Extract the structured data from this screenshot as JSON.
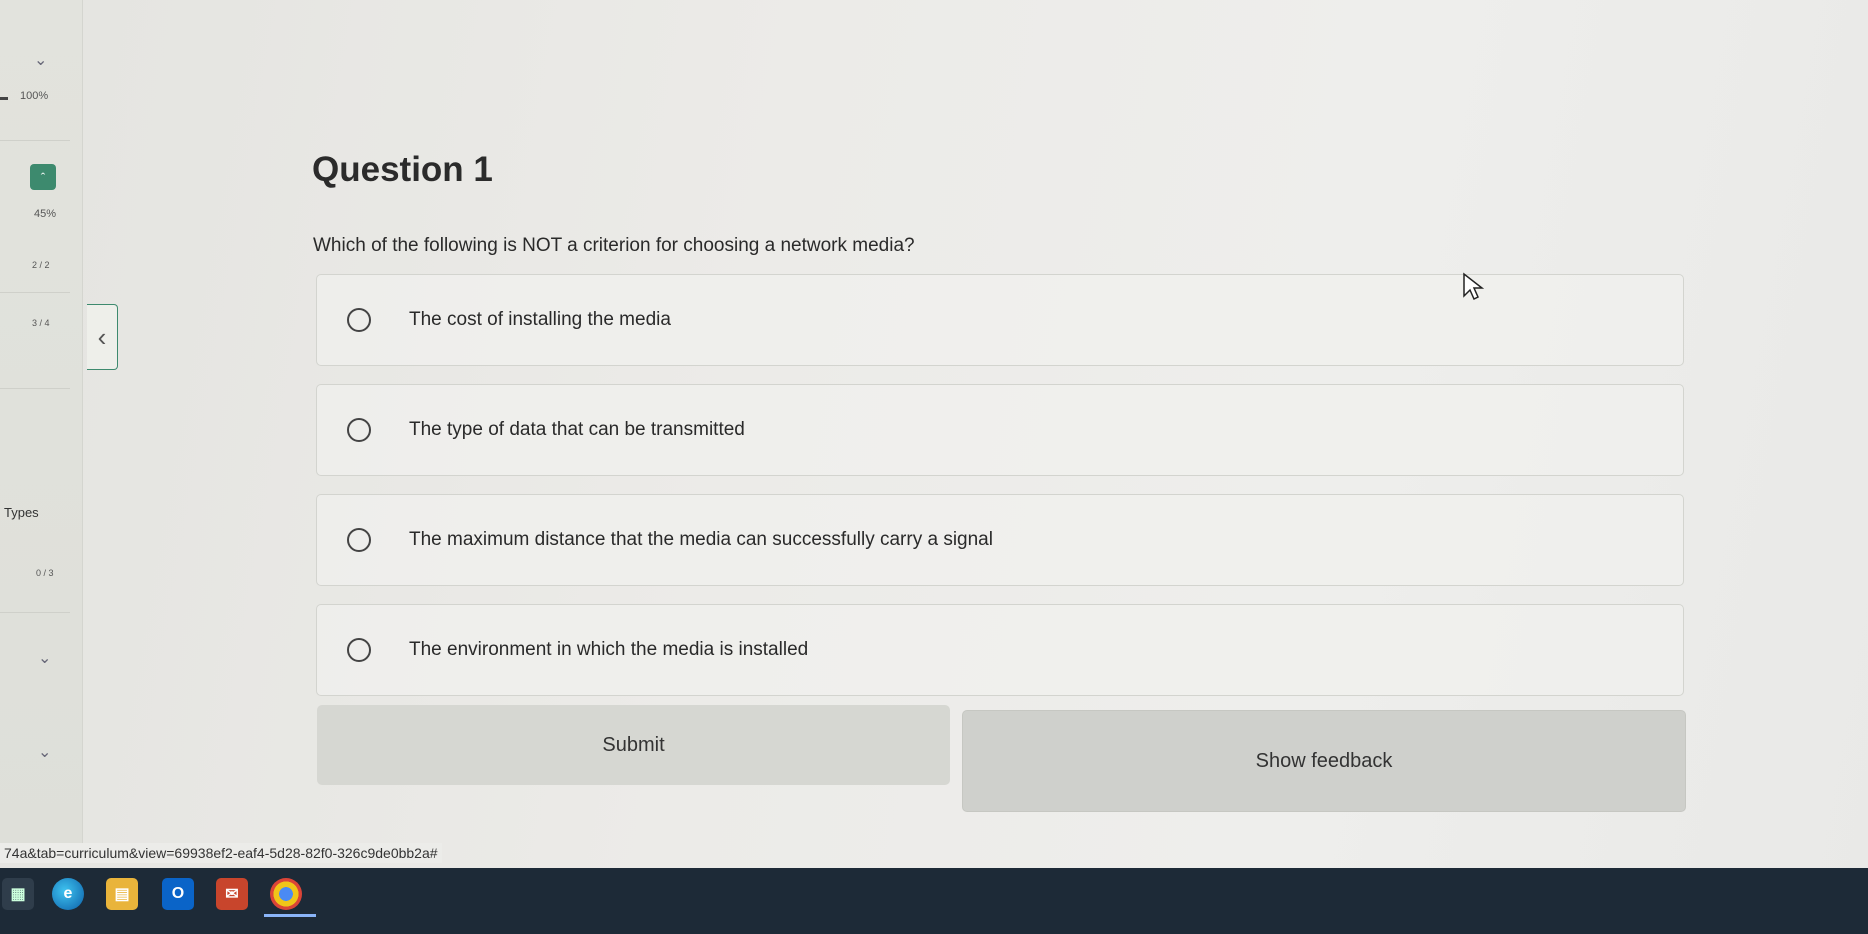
{
  "sidebar": {
    "progress_top": "100%",
    "progress_mid": "45%",
    "count_1": "2 / 2",
    "count_2": "3 / 4",
    "section_label": "Types",
    "count_3": "0 / 3",
    "collapse_glyph": "‹"
  },
  "question": {
    "title": "Question 1",
    "text": "Which of the following is NOT a criterion for choosing a network media?",
    "options": [
      {
        "label": "The cost of installing the media"
      },
      {
        "label": "The type of data that can be transmitted"
      },
      {
        "label": "The maximum distance that the media can successfully carry a signal"
      },
      {
        "label": "The environment in which the media is installed"
      }
    ]
  },
  "actions": {
    "submit_label": "Submit",
    "feedback_label": "Show feedback"
  },
  "status_url": "74a&tab=curriculum&view=69938ef2-eaf4-5d28-82f0-326c9de0bb2a#",
  "taskbar": {
    "icons": [
      "widgets-icon",
      "edge-icon",
      "file-explorer-icon",
      "outlook-icon",
      "mail-icon",
      "chrome-icon"
    ]
  },
  "colors": {
    "accent": "#3d8a6e",
    "taskbar": "#1d2a37"
  }
}
